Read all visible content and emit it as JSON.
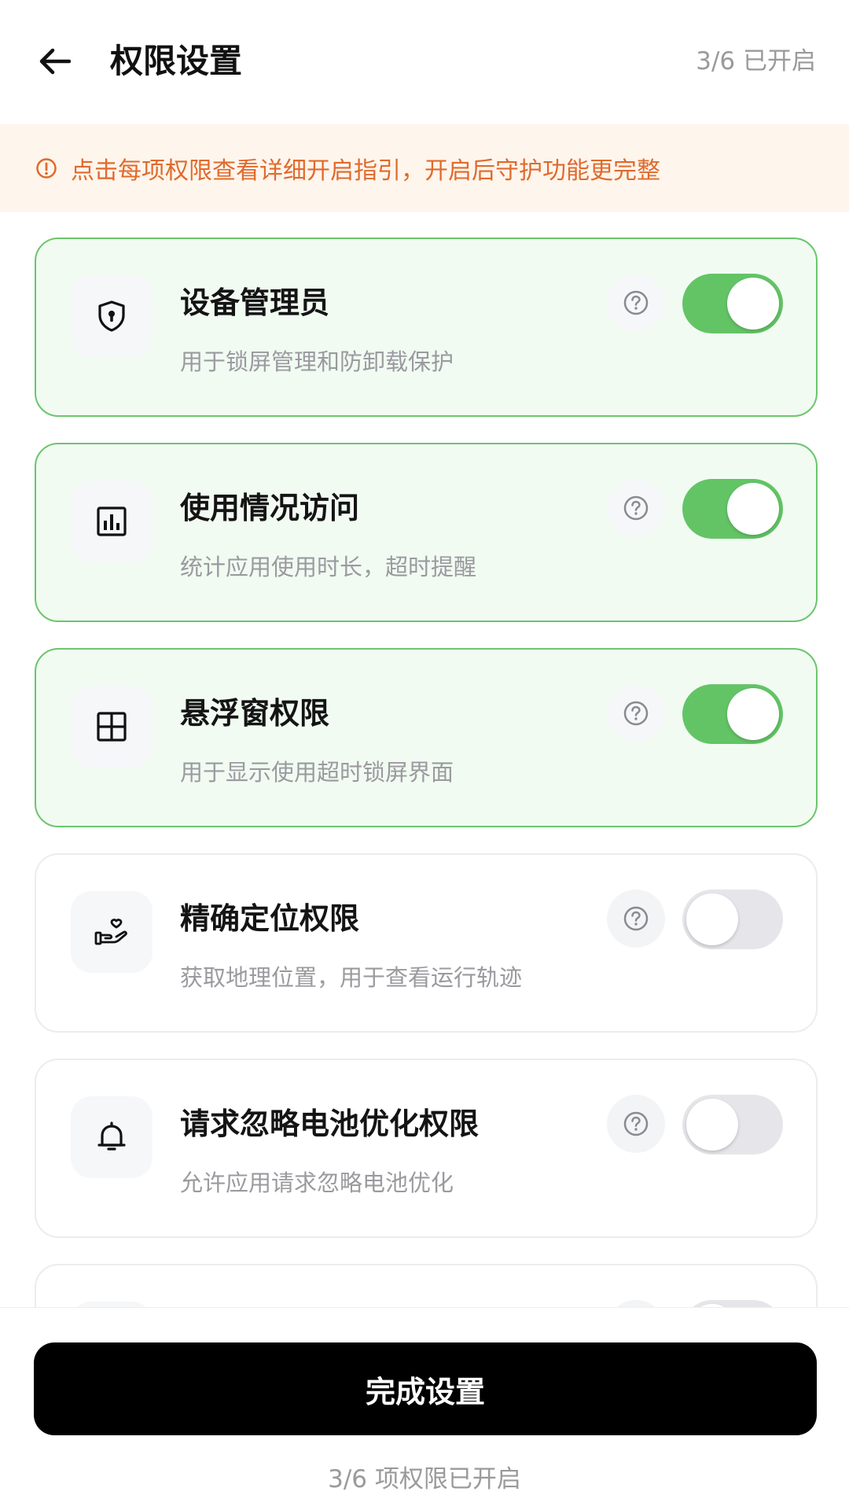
{
  "header": {
    "title": "权限设置",
    "status": "3/6 已开启"
  },
  "notice": {
    "text": "点击每项权限查看详细开启指引，开启后守护功能更完整",
    "icon": "info-icon",
    "color": "#e06a2c"
  },
  "permissions": [
    {
      "title": "设备管理员",
      "desc": "用于锁屏管理和防卸载保护",
      "enabled": true,
      "icon": "shield-lock-icon"
    },
    {
      "title": "使用情况访问",
      "desc": "统计应用使用时长，超时提醒",
      "enabled": true,
      "icon": "bar-chart-icon"
    },
    {
      "title": "悬浮窗权限",
      "desc": "用于显示使用超时锁屏界面",
      "enabled": true,
      "icon": "layout-window-icon"
    },
    {
      "title": "精确定位权限",
      "desc": "获取地理位置，用于查看运行轨迹",
      "enabled": false,
      "icon": "hand-heart-icon"
    },
    {
      "title": "请求忽略电池优化权限",
      "desc": "允许应用请求忽略电池优化",
      "enabled": false,
      "icon": "bell-icon"
    }
  ],
  "footer": {
    "button_label": "完成设置",
    "status": "3/6 项权限已开启"
  },
  "colors": {
    "accent_green": "#63c466",
    "card_on_bg": "#f1fbf2",
    "notice_bg": "#fef5ec"
  }
}
